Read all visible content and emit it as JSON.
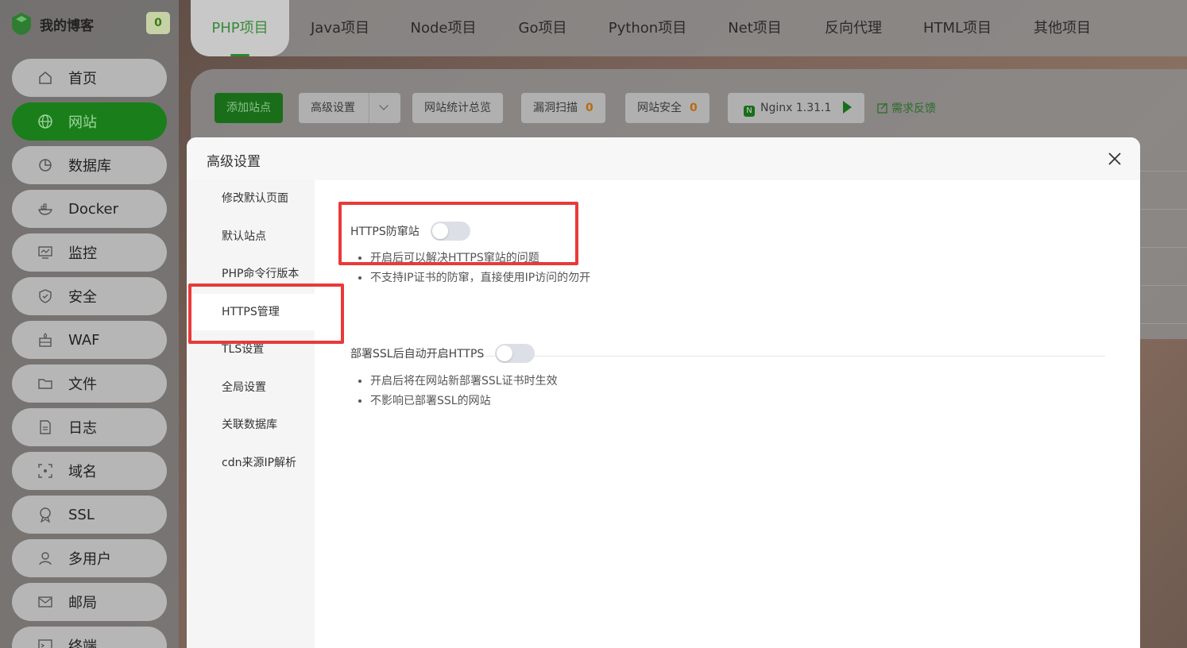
{
  "brand": {
    "title": "我的博客",
    "badge": "0"
  },
  "sidebar": {
    "items": [
      {
        "label": "首页",
        "icon": "home-icon"
      },
      {
        "label": "网站",
        "icon": "globe-icon",
        "active": true
      },
      {
        "label": "数据库",
        "icon": "database-icon"
      },
      {
        "label": "Docker",
        "icon": "docker-icon"
      },
      {
        "label": "监控",
        "icon": "monitor-icon"
      },
      {
        "label": "安全",
        "icon": "shield-icon"
      },
      {
        "label": "WAF",
        "icon": "firewall-icon"
      },
      {
        "label": "文件",
        "icon": "folder-icon"
      },
      {
        "label": "日志",
        "icon": "log-icon"
      },
      {
        "label": "域名",
        "icon": "domain-icon"
      },
      {
        "label": "SSL",
        "icon": "ssl-icon"
      },
      {
        "label": "多用户",
        "icon": "user-icon"
      },
      {
        "label": "邮局",
        "icon": "mail-icon"
      },
      {
        "label": "终端",
        "icon": "terminal-icon"
      }
    ]
  },
  "tabs": [
    {
      "label": "PHP项目",
      "active": true
    },
    {
      "label": "Java项目"
    },
    {
      "label": "Node项目"
    },
    {
      "label": "Go项目"
    },
    {
      "label": "Python项目"
    },
    {
      "label": "Net项目"
    },
    {
      "label": "反向代理"
    },
    {
      "label": "HTML项目"
    },
    {
      "label": "其他项目"
    }
  ],
  "toolbar": {
    "add_site": "添加站点",
    "advanced": "高级设置",
    "stats": "网站统计总览",
    "vuln_scan": "漏洞扫描",
    "vuln_count": "0",
    "site_security": "网站安全",
    "security_count": "0",
    "nginx": "Nginx 1.31.1",
    "feedback": "需求反馈"
  },
  "modal": {
    "title": "高级设置",
    "menu": [
      {
        "label": "修改默认页面"
      },
      {
        "label": "默认站点"
      },
      {
        "label": "PHP命令行版本"
      },
      {
        "label": "HTTPS管理",
        "active": true
      },
      {
        "label": "TLS设置"
      },
      {
        "label": "全局设置"
      },
      {
        "label": "关联数据库"
      },
      {
        "label": "cdn来源IP解析"
      }
    ],
    "settings": [
      {
        "label": "HTTPS防窜站",
        "enabled": false,
        "tips": [
          "开启后可以解决HTTPS窜站的问题",
          "不支持IP证书的防窜，直接使用IP访问的勿开"
        ]
      },
      {
        "label": "部署SSL后自动开启HTTPS",
        "enabled": false,
        "tips": [
          "开启后将在网站新部署SSL证书时生效",
          "不影响已部署SSL的网站"
        ]
      }
    ]
  },
  "colors": {
    "accent": "#1a7f1a",
    "highlight": "#e83a3a"
  }
}
